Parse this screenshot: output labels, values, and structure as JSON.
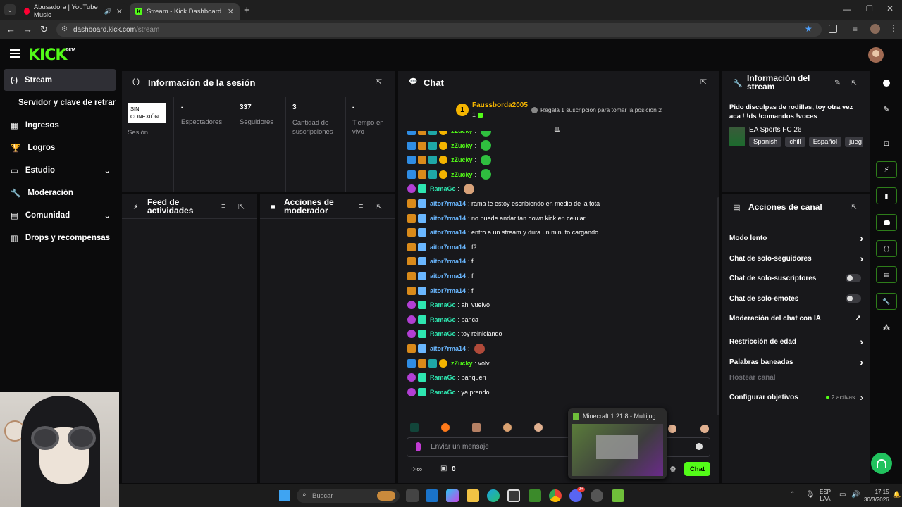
{
  "browser": {
    "tabs": [
      {
        "title": "Abusadora | YouTube Music"
      },
      {
        "title": "Stream - Kick Dashboard"
      }
    ],
    "url_host": "dashboard.kick.com",
    "url_path": "/stream"
  },
  "logo": {
    "text": "KICK",
    "badge": "BETA"
  },
  "sidebar": {
    "items": [
      {
        "label": "Stream",
        "icon": "broadcast-icon"
      },
      {
        "label": "Servidor y clave de retransmisión",
        "icon": ""
      },
      {
        "label": "Ingresos",
        "icon": "chart-icon"
      },
      {
        "label": "Logros",
        "icon": "trophy-icon"
      },
      {
        "label": "Estudio",
        "icon": "studio-icon"
      },
      {
        "label": "Moderación",
        "icon": "wrench-icon"
      },
      {
        "label": "Comunidad",
        "icon": "community-icon"
      },
      {
        "label": "Drops y recompensas",
        "icon": "drops-icon"
      }
    ]
  },
  "session": {
    "title": "Información de la sesión",
    "status_badge": "SIN CONEXIÓN",
    "status_label": "Sesión",
    "stats": [
      {
        "value": "-",
        "label": "Espectadores"
      },
      {
        "value": "337",
        "label": "Seguidores"
      },
      {
        "value": "3",
        "label": "Cantidad de suscripciones"
      },
      {
        "value": "-",
        "label": "Tiempo en vivo"
      }
    ]
  },
  "feed": {
    "title": "Feed de actividades"
  },
  "modactions": {
    "title": "Acciones de moderador"
  },
  "chat": {
    "title": "Chat",
    "pinned_user": "Faussborda2005",
    "pinned_count": "1",
    "gift_text": "Regala 1 suscripción para tomar la posición 2",
    "messages": [
      {
        "user": "zZucky",
        "text": ":",
        "color": "#53fc18"
      },
      {
        "user": "zZucky",
        "text": ":",
        "color": "#53fc18"
      },
      {
        "user": "zZucky",
        "text": ":",
        "color": "#53fc18"
      },
      {
        "user": "zZucky",
        "text": ":",
        "color": "#53fc18"
      },
      {
        "user": "RamaGc",
        "text": ":",
        "color": "#2ee6b0"
      },
      {
        "user": "aitor7rma14",
        "text": ": rama te estoy escribiendo en medio de la tota",
        "color": "#6ab7ff"
      },
      {
        "user": "aitor7rma14",
        "text": ": no puede andar tan down kick en celular",
        "color": "#6ab7ff"
      },
      {
        "user": "aitor7rma14",
        "text": ": entro a un stream y dura un minuto cargando",
        "color": "#6ab7ff"
      },
      {
        "user": "aitor7rma14",
        "text": ": f?",
        "color": "#6ab7ff"
      },
      {
        "user": "aitor7rma14",
        "text": ": f",
        "color": "#6ab7ff"
      },
      {
        "user": "aitor7rma14",
        "text": ": f",
        "color": "#6ab7ff"
      },
      {
        "user": "aitor7rma14",
        "text": ": f",
        "color": "#6ab7ff"
      },
      {
        "user": "RamaGc",
        "text": ": ahi vuelvo",
        "color": "#2ee6b0"
      },
      {
        "user": "RamaGc",
        "text": ": banca",
        "color": "#2ee6b0"
      },
      {
        "user": "RamaGc",
        "text": ": toy reiniciando",
        "color": "#2ee6b0"
      },
      {
        "user": "aitor7rma14",
        "text": ":",
        "color": "#6ab7ff"
      },
      {
        "user": "zZucky",
        "text": ": volvi",
        "color": "#53fc18"
      },
      {
        "user": "RamaGc",
        "text": ": banquen",
        "color": "#2ee6b0"
      },
      {
        "user": "RamaGc",
        "text": ": ya prendo",
        "color": "#2ee6b0"
      }
    ],
    "input_placeholder": "Enviar un mensaje",
    "points_value": "0",
    "send_label": "Chat"
  },
  "stream_info": {
    "title": "Información del stream",
    "stream_title": "Pido disculpas de rodillas, toy otra vez aca ! !ds !comandos !voces",
    "game": "EA Sports FC 26",
    "tags": [
      "Spanish",
      "chill",
      "Español",
      "jueg"
    ]
  },
  "channel_actions": {
    "title": "Acciones de canal",
    "rows": [
      {
        "label": "Modo lento",
        "control": "chevron"
      },
      {
        "label": "Chat de solo-seguidores",
        "control": "chevron"
      },
      {
        "label": "Chat de solo-suscriptores",
        "control": "toggle"
      },
      {
        "label": "Chat de solo-emotes",
        "control": "toggle"
      },
      {
        "label": "Moderación del chat con IA",
        "control": "external"
      },
      {
        "label": "Restricción de edad",
        "control": "chevron"
      },
      {
        "label": "Palabras baneadas",
        "control": "chevron"
      },
      {
        "label": "Hostear canal",
        "control": "none"
      },
      {
        "label": "Configurar objetivos",
        "control": "chevron"
      }
    ],
    "goals_badge": "2 activas"
  },
  "popup": {
    "title": "Minecraft 1.21.8 - Multijug..."
  },
  "taskbar": {
    "search_placeholder": "Buscar",
    "lang": "ESP",
    "lang_sub": "LAA",
    "time": "17:15",
    "date": "30/3/2026",
    "badge": "9+"
  },
  "colors": {
    "accent": "#53fc18",
    "panel": "#18181b",
    "bg": "#0b0b0c"
  }
}
